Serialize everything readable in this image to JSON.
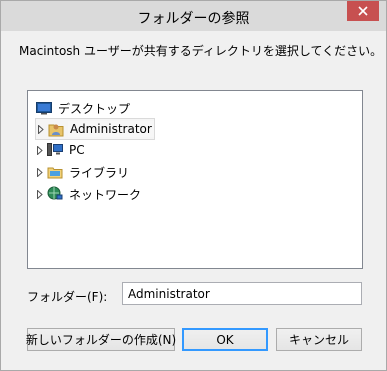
{
  "window": {
    "title": "フォルダーの参照",
    "close_label": "×"
  },
  "instruction": "Macintosh ユーザーが共有するディレクトリを選択してください。",
  "tree": {
    "items": [
      {
        "label": "デスクトップ",
        "icon": "desktop-icon",
        "expandable": false,
        "selected": false
      },
      {
        "label": "Administrator",
        "icon": "user-folder-icon",
        "expandable": true,
        "selected": true
      },
      {
        "label": "PC",
        "icon": "computer-icon",
        "expandable": true,
        "selected": false
      },
      {
        "label": "ライブラリ",
        "icon": "library-icon",
        "expandable": true,
        "selected": false
      },
      {
        "label": "ネットワーク",
        "icon": "network-icon",
        "expandable": true,
        "selected": false
      }
    ]
  },
  "folder": {
    "label": "フォルダー(F):",
    "value": "Administrator"
  },
  "buttons": {
    "new_folder": "新しいフォルダーの作成(N)",
    "ok": "OK",
    "cancel": "キャンセル"
  }
}
